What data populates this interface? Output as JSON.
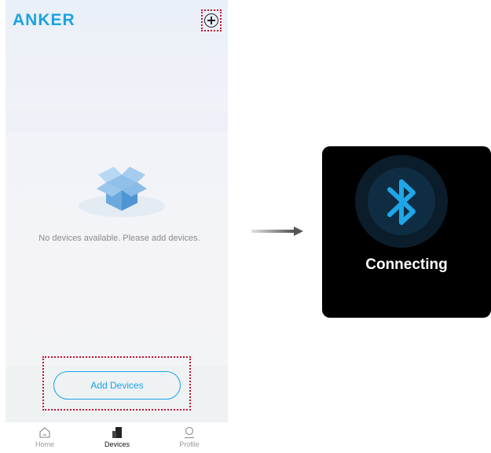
{
  "app": {
    "brand_name": "ANKER",
    "brand_color": "#1aa3e0"
  },
  "header": {
    "add_icon": "circle-plus-icon"
  },
  "empty_state": {
    "icon": "open-box-icon",
    "message": "No devices available. Please add devices."
  },
  "actions": {
    "add_devices_label": "Add Devices"
  },
  "tabs": [
    {
      "label": "Home",
      "icon": "home-icon",
      "active": false
    },
    {
      "label": "Devices",
      "icon": "devices-icon",
      "active": true
    },
    {
      "label": "Profile",
      "icon": "profile-icon",
      "active": false
    }
  ],
  "transition": {
    "icon": "right-arrow-icon"
  },
  "connecting_screen": {
    "icon": "bluetooth-icon",
    "status": "Connecting",
    "accent": "#1fa6e8"
  },
  "colors": {
    "highlight_frame": "#c8102e",
    "accent": "#1ba2e6"
  }
}
